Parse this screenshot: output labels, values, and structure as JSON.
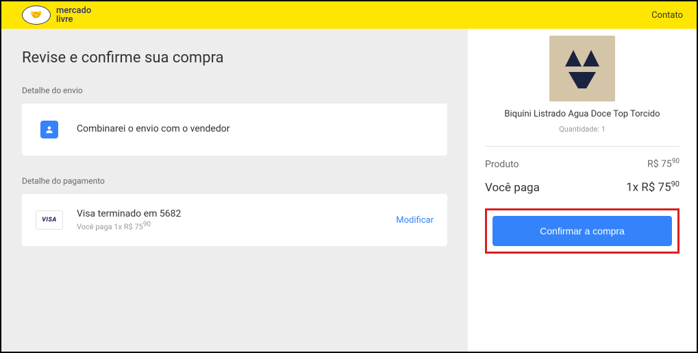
{
  "header": {
    "brand_line1": "mercado",
    "brand_line2": "livre",
    "contact": "Contato"
  },
  "main": {
    "title": "Revise e confirme sua compra",
    "shipping": {
      "section_label": "Detalhe do envio",
      "text": "Combinarei o envio com o vendedor"
    },
    "payment": {
      "section_label": "Detalhe do pagamento",
      "card_text": "Visa terminado em 5682",
      "sub_html": "Você paga 1x R$ 75",
      "sub_cents": "90",
      "modify": "Modificar",
      "visa_label": "VISA"
    }
  },
  "summary": {
    "product_name": "Biquíni Listrado Agua Doce Top Torcido",
    "quantity_label": "Quantidade: 1",
    "product_row_label": "Produto",
    "product_price": "R$ 75",
    "product_cents": "90",
    "total_label": "Você paga",
    "total_price": "1x R$ 75",
    "total_cents": "90",
    "confirm": "Confirmar a compra"
  }
}
